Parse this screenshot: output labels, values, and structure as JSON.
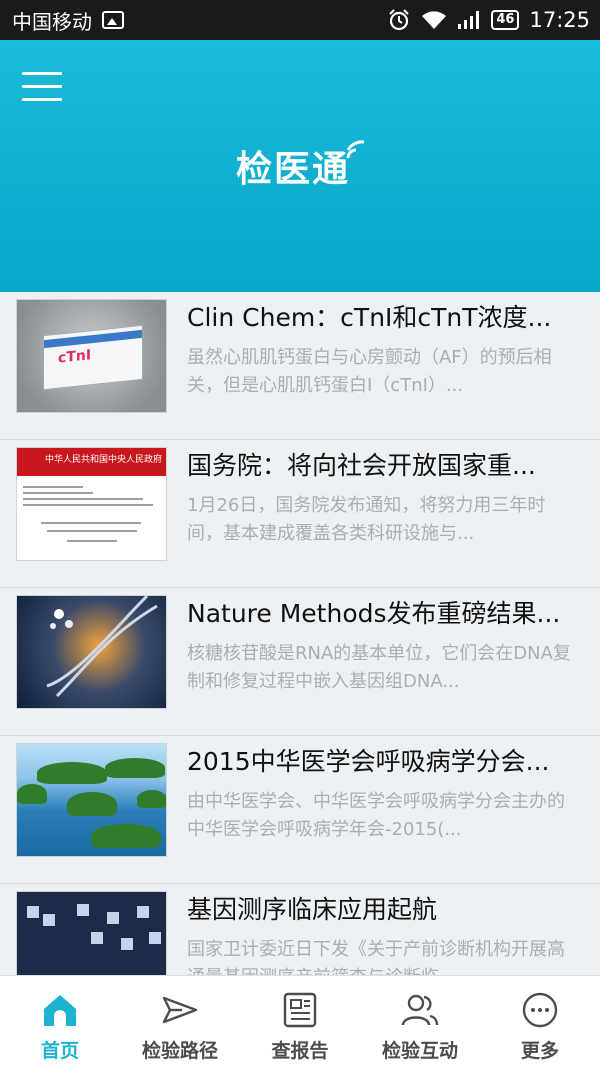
{
  "status_bar": {
    "carrier": "中国移动",
    "network_badge": "46",
    "time": "17:25",
    "icons": [
      "image-icon",
      "alarm-icon",
      "wifi-icon",
      "signal-icon",
      "battery-icon"
    ]
  },
  "header": {
    "logo_text": "检医通",
    "color": "#11b2d3"
  },
  "news": [
    {
      "title": "Clin Chem：cTnI和cTnT浓度...",
      "summary": "虽然心肌肌钙蛋白与心房颤动（AF）的预后相关，但是心肌肌钙蛋白I（cTnI）...",
      "thumb_label": "cTnI"
    },
    {
      "title": "国务院：将向社会开放国家重...",
      "summary": "1月26日，国务院发布通知，将努力用三年时间，基本建成覆盖各类科研设施与...",
      "thumb_label": "中华人民共和国中央人民政府"
    },
    {
      "title": "Nature Methods发布重磅结果...",
      "summary": "核糖核苷酸是RNA的基本单位，它们会在DNA复制和修复过程中嵌入基因组DNA..."
    },
    {
      "title": "2015中华医学会呼吸病学分会...",
      "summary": "由中华医学会、中华医学会呼吸病学分会主办的中华医学会呼吸病学年会-2015(..."
    },
    {
      "title": "基因测序临床应用起航",
      "summary": "国家卫计委近日下发《关于产前诊断机构开展高通量基因测序产前筛查与诊断临..."
    }
  ],
  "tabs": [
    {
      "label": "首页",
      "icon": "home-icon",
      "active": true
    },
    {
      "label": "检验路径",
      "icon": "send-icon",
      "active": false
    },
    {
      "label": "查报告",
      "icon": "report-icon",
      "active": false
    },
    {
      "label": "检验互动",
      "icon": "users-icon",
      "active": false
    },
    {
      "label": "更多",
      "icon": "more-icon",
      "active": false
    }
  ],
  "colors": {
    "accent": "#1cb3d3",
    "tab_inactive": "#4a4d50",
    "summary_text": "#a9aeb2"
  }
}
